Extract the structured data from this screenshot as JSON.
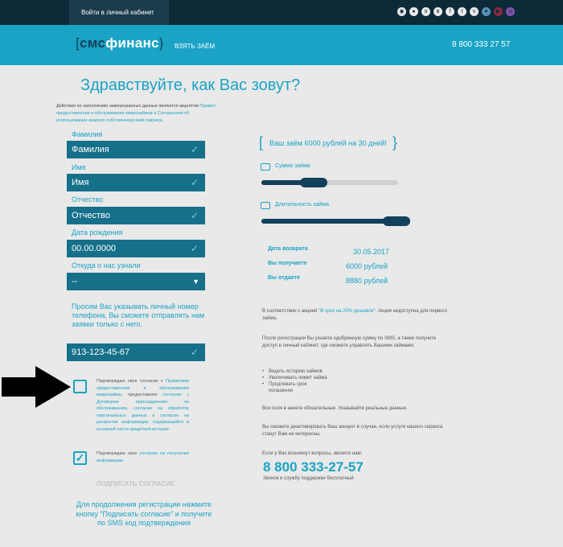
{
  "topbar": {
    "login_label": "Войти в личный кабинет",
    "social_icons": [
      "android-icon",
      "apple-icon",
      "odnoklassniki-icon",
      "vk-icon",
      "facebook-icon",
      "twitter-icon",
      "viber-icon",
      "telegram-icon",
      "youtube-icon",
      "instagram-icon"
    ]
  },
  "header": {
    "logo_open": "[",
    "logo_sms": "смс",
    "logo_fin": "финанс",
    "logo_close": "}",
    "nav_take_loan": "ВЗЯТЬ ЗАЁМ",
    "phone": "8 800 333 27 57"
  },
  "page": {
    "title": "Здравствуйте, как Вас зовут?",
    "intro_text": "Действия по заполнению нижеуказанных данных являются акцептом",
    "intro_link": "Правил предоставления и обслуживания микрозаймов и Соглашения об использовании аналога собственноручной подписи."
  },
  "form": {
    "lastname_label": "Фамилия",
    "lastname_value": "Фамилия",
    "firstname_label": "Имя",
    "firstname_value": "Имя",
    "middlename_label": "Отчество",
    "middlename_value": "Отчество",
    "birthdate_label": "Дата рождения",
    "birthdate_value": "00.00.0000",
    "source_label": "Откуда о нас узнали",
    "source_value": "--",
    "phone_note": "Просим Вас указывать личный номер телефона, Вы сможете отправлять нам заявки только с него.",
    "phone_value": "913-123-45-67",
    "check_glyph": "✓",
    "dropdown_glyph": "▼"
  },
  "consent": {
    "c1_a": "Подтверждаю свое согласие с ",
    "c1_link1": "Правилами предоставления и обслуживания микрозайма",
    "c1_b": ", предоставляю ",
    "c1_link2": "согласие с Договором присоединения по обслуживанию, согласие на обработку персональных данных и согласие на раскрытие информации, содержащейся в основной части кредитной истории",
    "c2_a": "Подтверждаю свое ",
    "c2_link": "согласие на получение информации",
    "checked_glyph": "✓",
    "sign_button": "ПОДПИСАТЬ СОГЛАСИЕ",
    "bottom_note": "Для продолжения регистрации нажмите кнопку \"Подписать согласие\" и получите по SMS код подтверждения"
  },
  "loan": {
    "summary": "Ваш заём 6000 рублей на 30 дней!",
    "amount_label": "Сумма займа",
    "amount_fraction": 0.35,
    "term_label": "Длительность займа",
    "term_fraction": 1.0,
    "return_date_label": "Дата возврата",
    "return_date_value": "30.05.2017",
    "receive_label": "Вы получаете",
    "receive_value": "6000 рублей",
    "pay_label": "Вы отдаете",
    "pay_value": "8880 рублей"
  },
  "info": {
    "promo_a": "В соответствии с акцией ",
    "promo_link": "\"В срок на 20% дешевле\"",
    "promo_b": ". Акция недоступна для первого займа.",
    "after_reg": "После регистрации Вы узнаете одобренную сумму по SMS, а также получите доступ в личный кабинет, где сможете управлять Вашими займами:",
    "list": [
      "Видеть историю займов",
      "Увеличивать лимит займа",
      "Продлевать срок погашения"
    ],
    "all_fields": "Все поля в анкете обязательные. Указывайте реальные данные.",
    "deactivate": "Вы сможете деактивировать Ваш аккаунт в случае, если услуги нашего сервиса станут Вам не интересны.",
    "questions": "Если у Вас возникнут вопросы, звоните нам:",
    "phone_big": "8 800 333-27-57",
    "phone_sub": "Звонок в службу поддержки бесплатный"
  },
  "colors": {
    "accent": "#1aa3c5",
    "field_bg": "#16708a",
    "dark": "#13405a"
  }
}
